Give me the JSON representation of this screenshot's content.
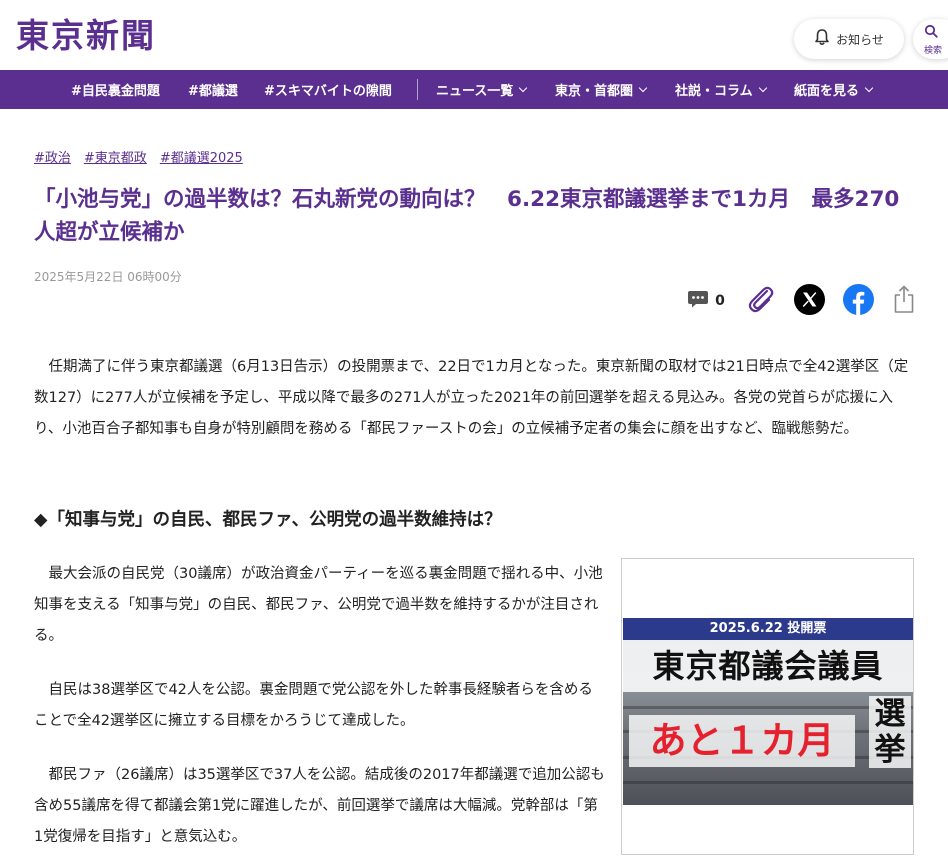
{
  "header": {
    "logo": "東京新聞",
    "notice_label": "お知らせ",
    "search_label": "検索"
  },
  "nav": {
    "items": [
      {
        "label": "#自民裏金問題",
        "dropdown": false
      },
      {
        "label": "#都議選",
        "dropdown": false
      },
      {
        "label": "#スキマバイトの隙間",
        "dropdown": false
      },
      {
        "label": "ニュース一覧",
        "dropdown": true
      },
      {
        "label": "東京・首都圏",
        "dropdown": true
      },
      {
        "label": "社説・コラム",
        "dropdown": true
      },
      {
        "label": "紙面を見る",
        "dropdown": true
      }
    ]
  },
  "article": {
    "tags": [
      "#政治",
      "#東京都政",
      "#都議選2025"
    ],
    "title": "「小池与党」の過半数は？石丸新党の動向は？　6.22東京都議選挙まで1カ月　最多270人超が立候補か",
    "date": "2025年5月22日 06時00分",
    "comment_count": "0",
    "intro": "任期満了に伴う東京都議選（6月13日告示）の投開票まで、22日で1カ月となった。東京新聞の取材では21日時点で全42選挙区（定数127）に277人が立候補を予定し、平成以降で最多の271人が立った2021年の前回選挙を超える見込み。各党の党首らが応援に入り、小池百合子都知事も自身が特別顧問を務める「都民ファーストの会」の立候補予定者の集会に顔を出すなど、臨戦態勢だ。",
    "heading": "◆「知事与党」の自民、都民ファ、公明党の過半数維持は？",
    "paragraphs": [
      "最大会派の自民党（30議席）が政治資金パーティーを巡る裏金問題で揺れる中、小池知事を支える「知事与党」の自民、都民ファ、公明党で過半数を維持するかが注目される。",
      "自民は38選挙区で42人を公認。裏金問題で党公認を外した幹事長経験者らを含めることで全42選挙区に擁立する目標をかろうじて達成した。",
      "都民ファ（26議席）は35選挙区で37人を公認。結成後の2017年都議選で追加公認も含め55議席を得て都議会第1党に躍進したが、前回選挙で議席は大幅減。党幹部は「第1党復帰を目指す」と意気込む。"
    ],
    "figure": {
      "band": "2025.6.22 投開票",
      "main": "東京都議会議員",
      "count": "あと１カ月",
      "vertical": "選挙"
    }
  },
  "colors": {
    "brand": "#5b2f8f",
    "accent_red": "#e6212e",
    "band_blue": "#2c3a8c"
  }
}
